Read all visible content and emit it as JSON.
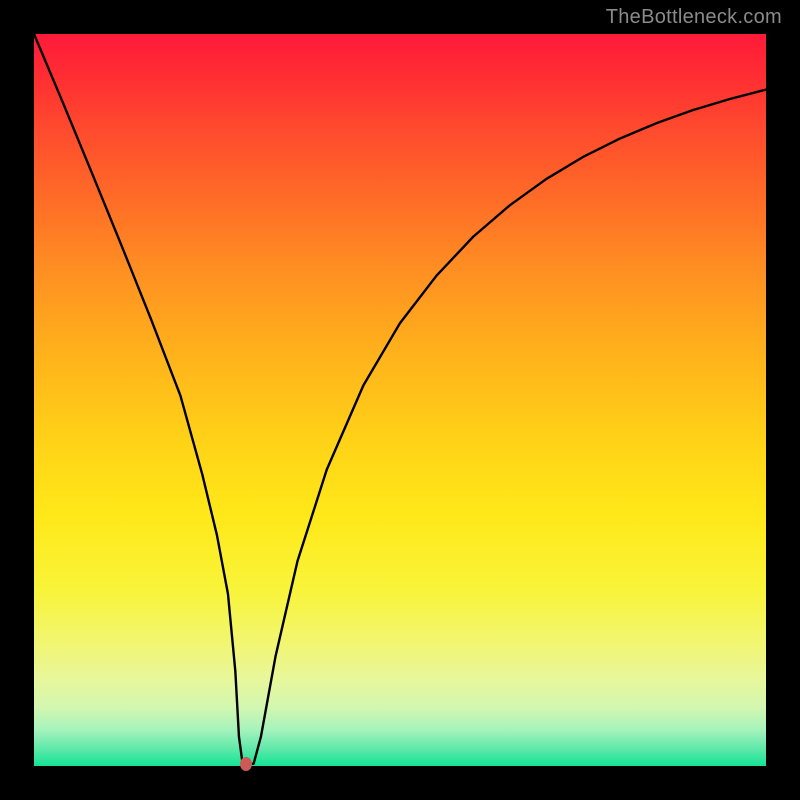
{
  "watermark": "TheBottleneck.com",
  "chart_data": {
    "type": "line",
    "title": "",
    "xlabel": "",
    "ylabel": "",
    "xlim": [
      0,
      100
    ],
    "ylim": [
      0,
      100
    ],
    "series": [
      {
        "name": "curve",
        "x": [
          0,
          4,
          8,
          12,
          16,
          20,
          23,
          25,
          26.5,
          27.5,
          28,
          28.5,
          29,
          30,
          31,
          33,
          36,
          40,
          45,
          50,
          55,
          60,
          65,
          70,
          75,
          80,
          85,
          90,
          95,
          100
        ],
        "values": [
          100,
          90.5,
          80.8,
          71,
          61,
          50.6,
          39.8,
          31.5,
          23.5,
          13,
          4,
          0.3,
          0.3,
          0.3,
          4,
          15,
          28,
          40.5,
          52,
          60.5,
          67,
          72.3,
          76.6,
          80.2,
          83.2,
          85.7,
          87.8,
          89.6,
          91.1,
          92.4
        ]
      }
    ],
    "marker": {
      "x": 29,
      "y": 0.3,
      "color": "#cc5a56"
    }
  }
}
